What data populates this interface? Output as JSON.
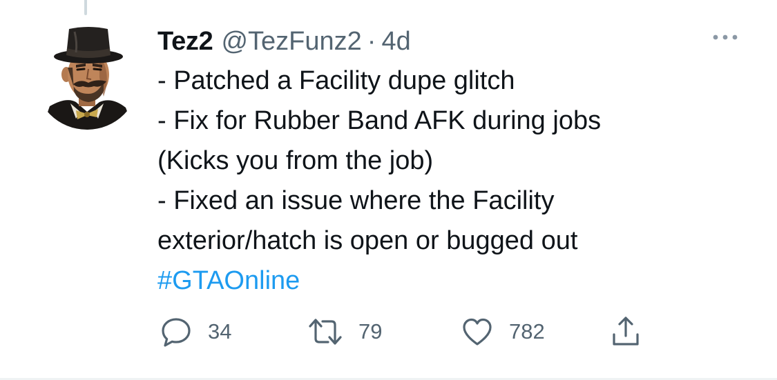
{
  "tweet": {
    "author": {
      "display_name": "Tez2",
      "handle": "@TezFunz2",
      "avatar_icon": "top-hat-gentleman-avatar"
    },
    "separator": "·",
    "age": "4d",
    "text_lines": [
      "- Patched a Facility dupe glitch",
      "- Fix for Rubber Band AFK during jobs",
      "(Kicks you from the job)",
      "- Fixed an issue where the Facility",
      "exterior/hatch is open or bugged out"
    ],
    "hashtag": "#GTAOnline",
    "more_icon": "more-horizontal-icon"
  },
  "actions": {
    "reply": {
      "icon": "reply-icon",
      "count": "34"
    },
    "retweet": {
      "icon": "retweet-icon",
      "count": "79"
    },
    "like": {
      "icon": "heart-icon",
      "count": "782"
    },
    "share": {
      "icon": "share-icon"
    }
  },
  "colors": {
    "text_primary": "#0f1419",
    "text_secondary": "#536471",
    "link": "#1d9bf0",
    "thread_line": "#cfd9de"
  }
}
